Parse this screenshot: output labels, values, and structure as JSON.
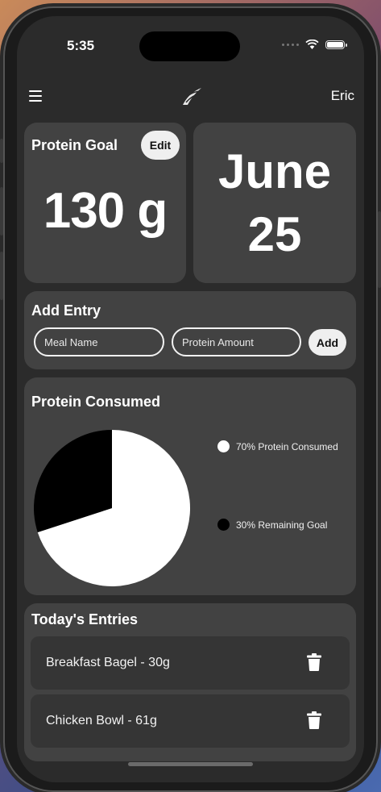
{
  "status": {
    "time": "5:35"
  },
  "header": {
    "user": "Eric"
  },
  "goal": {
    "title": "Protein Goal",
    "edit_label": "Edit",
    "value": "130 g"
  },
  "date": {
    "month": "June",
    "day": "25"
  },
  "add_entry": {
    "title": "Add Entry",
    "meal_placeholder": "Meal Name",
    "amount_placeholder": "Protein Amount",
    "add_label": "Add"
  },
  "consumed": {
    "title": "Protein Consumed"
  },
  "chart_data": {
    "type": "pie",
    "categories": [
      "Protein Consumed",
      "Remaining Goal"
    ],
    "values": [
      70,
      30
    ],
    "colors": [
      "#ffffff",
      "#000000"
    ],
    "legend": [
      "70% Protein Consumed",
      "30% Remaining Goal"
    ],
    "legend_position": "right"
  },
  "entries": {
    "title": "Today's Entries",
    "items": [
      {
        "label": "Breakfast Bagel - 30g"
      },
      {
        "label": "Chicken Bowl - 61g"
      }
    ]
  }
}
